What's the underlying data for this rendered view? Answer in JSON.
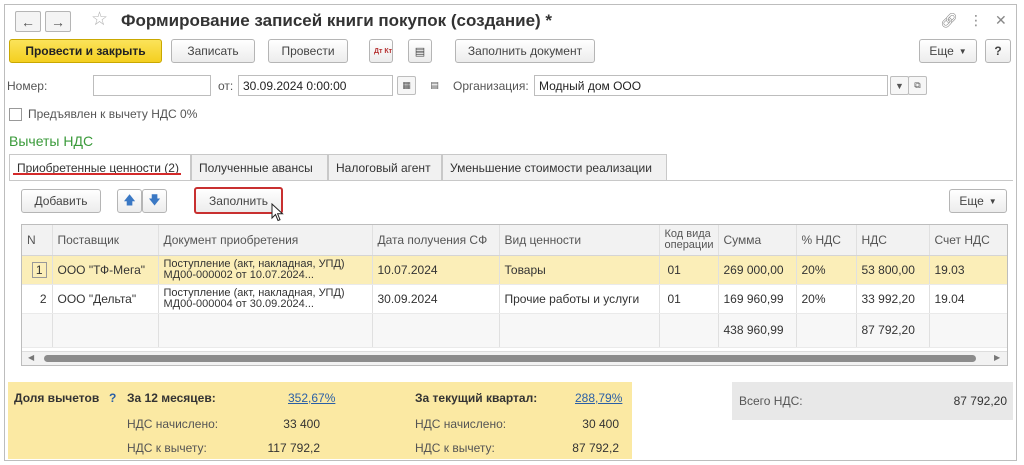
{
  "window": {
    "title": "Формирование записей книги покупок (создание) *"
  },
  "toolbar": {
    "post_close": "Провести и закрыть",
    "save": "Записать",
    "post": "Провести",
    "dt_kt": "Дт Кт",
    "fill_doc": "Заполнить документ",
    "more": "Еще",
    "help": "?"
  },
  "form": {
    "number_label": "Номер:",
    "number_value": "",
    "date_label": "от:",
    "date_value": "30.09.2024  0:00:00",
    "org_label": "Организация:",
    "org_value": "Модный дом ООО",
    "vat0_label": "Предъявлен к вычету НДС 0%"
  },
  "section_title": "Вычеты НДС",
  "tabs": [
    {
      "label": "Приобретенные ценности (2)"
    },
    {
      "label": "Полученные авансы"
    },
    {
      "label": "Налоговый агент"
    },
    {
      "label": "Уменьшение стоимости реализации"
    }
  ],
  "table_toolbar": {
    "add": "Добавить",
    "fill": "Заполнить",
    "more": "Еще"
  },
  "table": {
    "headers": [
      "N",
      "Поставщик",
      "Документ приобретения",
      "Дата получения СФ",
      "Вид ценности",
      "Код вида операции",
      "Сумма",
      "% НДС",
      "НДС",
      "Счет НДС"
    ],
    "rows": [
      {
        "n": "1",
        "supplier": "ООО \"ТФ-Мега\"",
        "doc_line1": "Поступление (акт, накладная, УПД)",
        "doc_line2": "МД00-000002 от 10.07.2024...",
        "date": "10.07.2024",
        "kind": "Товары",
        "code": "01",
        "sum": "269 000,00",
        "pct": "20%",
        "vat": "53 800,00",
        "account": "19.03"
      },
      {
        "n": "2",
        "supplier": "ООО \"Дельта\"",
        "doc_line1": "Поступление (акт, накладная, УПД)",
        "doc_line2": "МД00-000004 от 30.09.2024...",
        "date": "30.09.2024",
        "kind": "Прочие работы и услуги",
        "code": "01",
        "sum": "169 960,99",
        "pct": "20%",
        "vat": "33 992,20",
        "account": "19.04"
      }
    ],
    "totals": {
      "sum": "438 960,99",
      "vat": "87 792,20"
    }
  },
  "summary": {
    "share_label": "Доля вычетов",
    "help": "?",
    "months12_label": "За 12 месяцев:",
    "months12_link": "352,67%",
    "accrued_label": "НДС начислено:",
    "accrued_12": "33 400",
    "deduct_label": "НДС к вычету:",
    "deduct_12": "117 792,2",
    "quarter_label": "За текущий квартал:",
    "quarter_link": "288,79%",
    "accrued_q": "30 400",
    "deduct_q": "87 792,2",
    "total_vat_label": "Всего НДС:",
    "total_vat_value": "87 792,20"
  }
}
